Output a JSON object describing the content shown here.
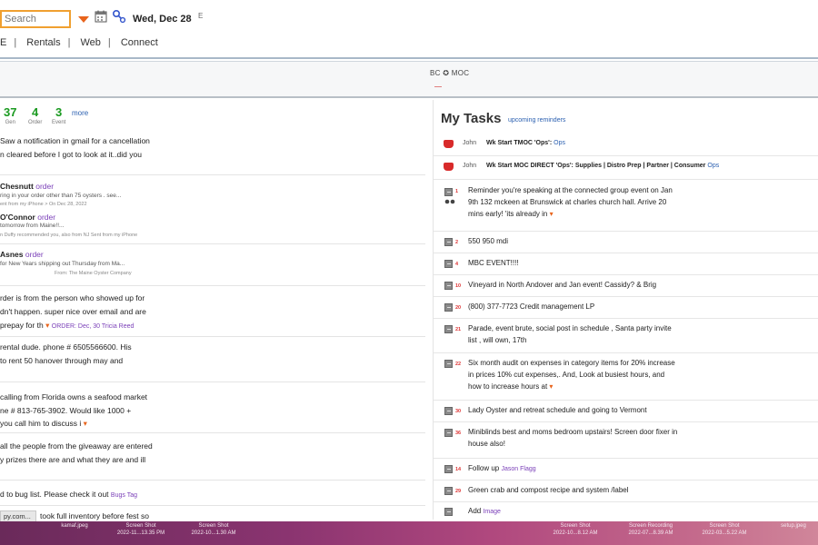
{
  "header": {
    "search_placeholder": "Search",
    "date": "Wed, Dec 28",
    "date_mark": "E"
  },
  "nav": {
    "items": [
      "E",
      "Rentals",
      "Web",
      "Connect"
    ]
  },
  "subbar": {
    "label": "BC ✪ MOC"
  },
  "stats": [
    {
      "value": "37",
      "label": "Gen"
    },
    {
      "value": "4",
      "label": "Order"
    },
    {
      "value": "3",
      "label": "Event"
    }
  ],
  "stats_more": "more",
  "feed": {
    "item1_l1": "Saw a notification in gmail for a cancellation",
    "item1_l2": "n cleared before I got to look at it..did you",
    "item2_name": "Chesnutt",
    "item2_tag": "order",
    "item2_l1": "ring in your order other than 75 oysters . see...",
    "item2_l2": "ent from my iPhone > On Dec 28, 2022",
    "item3_name": "O'Connor",
    "item3_tag": "order",
    "item3_l1": "tomorrow from Maine!!...",
    "item3_l2": "n Duffy recommended you, also from NJ Sent from my iPhone",
    "item4_name": "Asnes",
    "item4_tag": "order",
    "item4_l1": "for New Years shipping out Thursday from Ma...",
    "item4_l2": "From: The Maine Oyster Company",
    "item5_l1": "rder is from the person who showed up for",
    "item5_l2": "dn't happen. super nice over email and are",
    "item5_l3": "prepay for th",
    "item5_link": "ORDER: Dec, 30 Tricia Reed",
    "item6_l1": "rental dude. phone # 6505566600. His",
    "item6_l2": "to rent 50 hanover through may and",
    "item7_l1": "calling from Florida owns a seafood market",
    "item7_l2": "ne # 813-765-3902. Would like 1000 +",
    "item7_l3": "you call him to discuss i",
    "item8_l1": "all the people from the giveaway are entered",
    "item8_l2": "y prizes there are and what they are and ill",
    "item9_l1": "d to bug list. Please check it out",
    "item9_link": "Bugs Tag",
    "item10_btn": "py.com...",
    "item10_l1": "took full inventory before fest so"
  },
  "tasks": {
    "title": "My Tasks",
    "subtitle": "upcoming reminders",
    "t1_who": "John",
    "t1_text": "Wk Start TMOC 'Ops':",
    "t1_link": "Ops",
    "t2_who": "John",
    "t2_text": "Wk Start MOC DIRECT 'Ops': Supplies  | Distro Prep | Partner | Consumer",
    "t2_link": "Ops",
    "t3_num": "1",
    "t3_l1": "Reminder you're speaking at the connected group event on Jan",
    "t3_l2": "9th 132 mckeen at Brunswick at charles church hall. Arrive 20",
    "t3_l3": "mins early! 'its already in",
    "t4_num": "2",
    "t4_text": "550 950 mdi",
    "t5_num": "4",
    "t5_text": "MBC EVENT!!!!",
    "t6_num": "10",
    "t6_text": "Vineyard in North Andover and Jan event! Cassidy? & Brig",
    "t7_num": "20",
    "t7_text": "(800) 377-7723 Credit management LP",
    "t8_num": "21",
    "t8_l1": "Parade, event brute, social post in schedule , Santa party invite",
    "t8_l2": "list , will own, 17th",
    "t9_num": "22",
    "t9_l1": "Six month audit on expenses in category items for 20% increase",
    "t9_l2": "in prices 10% cut expenses,. And, Look at busiest hours, and",
    "t9_l3": "how to increase hours at",
    "t10_num": "30",
    "t10_text": "Lady Oyster and retreat schedule and going to Vermont",
    "t11_num": "36",
    "t11_l1": "Miniblinds best and moms bedroom upstairs! Screen door fixer in",
    "t11_l2": "house also!",
    "t12_num": "14",
    "t12_text": "Follow up",
    "t12_link": "Jason Flagg",
    "t13_num": "29",
    "t13_text": "Green crab and compost recipe and system /label",
    "t14_num": "",
    "t14_text": "Add",
    "t14_link": "Image"
  },
  "dock": {
    "files": [
      {
        "name": "kamaf.jpeg",
        "meta": ""
      },
      {
        "name": "Screen Shot",
        "meta": "2022-11...13.35 PM"
      },
      {
        "name": "Screen Shot",
        "meta": "2022-10...1.30 AM"
      },
      {
        "name": "Screen Shot",
        "meta": "2022-10...8.12 AM"
      },
      {
        "name": "Screen Recording",
        "meta": "2022-07...8.39 AM"
      },
      {
        "name": "Screen Shot",
        "meta": "2022-03...5.22 AM"
      },
      {
        "name": "setup.jpeg",
        "meta": ""
      }
    ]
  },
  "colors": {
    "accent_orange": "#e8641c",
    "stat_green": "#1a9a20",
    "link_blue": "#2a5fb0",
    "tag_purple": "#7a3fb8",
    "thumb_red": "#d82a2a"
  }
}
